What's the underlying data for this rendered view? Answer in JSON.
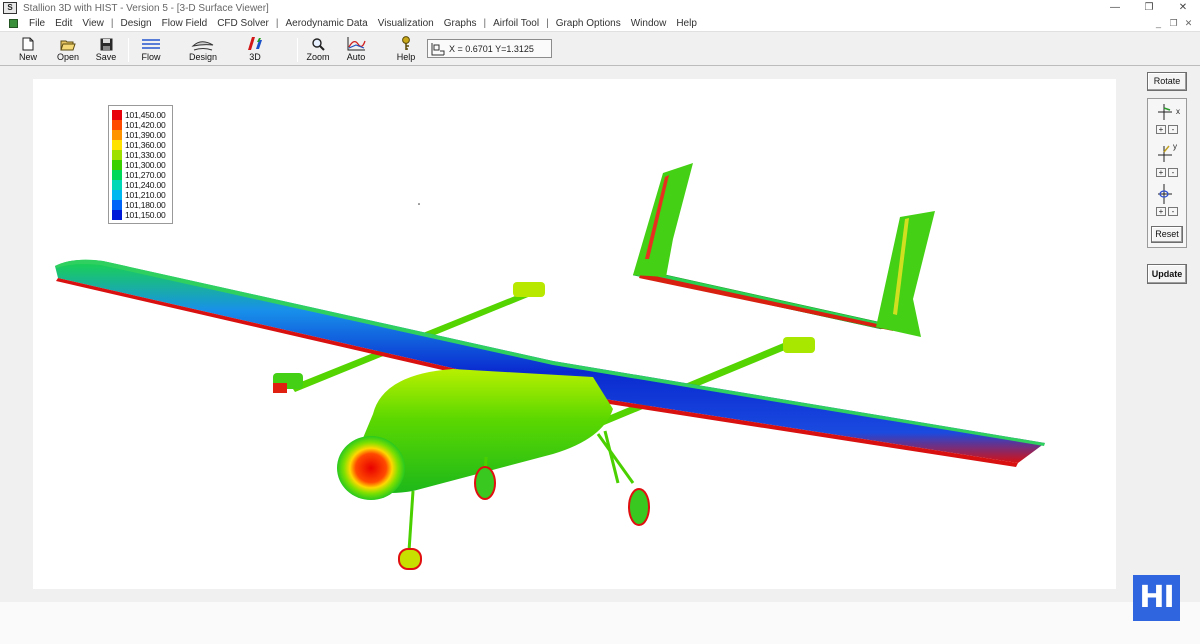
{
  "window": {
    "title": "Stallion 3D with HIST - Version 5 - [3-D Surface Viewer]",
    "app_icon_text": "S",
    "controls": [
      "minimize",
      "restore",
      "close"
    ]
  },
  "menu": {
    "items": [
      "File",
      "Edit",
      "View",
      "|",
      "Design",
      "Flow Field",
      "CFD Solver",
      "|",
      "Aerodynamic Data",
      "Visualization",
      "Graphs",
      "|",
      "Airfoil Tool",
      "|",
      "Graph Options",
      "Window",
      "Help"
    ],
    "mdi_controls": [
      "minimize",
      "restore",
      "close"
    ]
  },
  "toolbar": {
    "new": "New",
    "open": "Open",
    "save": "Save",
    "flow": "Flow",
    "design": "Design",
    "three_d": "3D",
    "zoom": "Zoom",
    "auto": "Auto",
    "help": "Help",
    "coords": "X = 0.6701  Y=1.3125"
  },
  "legend": {
    "entries": [
      {
        "label": "101,450.00",
        "color": "#e8000a"
      },
      {
        "label": "101,420.00",
        "color": "#ff4a00"
      },
      {
        "label": "101,390.00",
        "color": "#ff9400"
      },
      {
        "label": "101,360.00",
        "color": "#ffe200"
      },
      {
        "label": "101,330.00",
        "color": "#9ee000"
      },
      {
        "label": "101,300.00",
        "color": "#3ad000"
      },
      {
        "label": "101,270.00",
        "color": "#00d85a"
      },
      {
        "label": "101,240.00",
        "color": "#00d8b8"
      },
      {
        "label": "101,210.00",
        "color": "#00b8f0"
      },
      {
        "label": "101,180.00",
        "color": "#0064f8"
      },
      {
        "label": "101,150.00",
        "color": "#0018d8"
      }
    ]
  },
  "side": {
    "rotate": "Rotate",
    "axis_x": "x",
    "axis_y": "y",
    "plus": "+",
    "minus": "-",
    "reset": "Reset",
    "update": "Update"
  },
  "badge": "HI"
}
